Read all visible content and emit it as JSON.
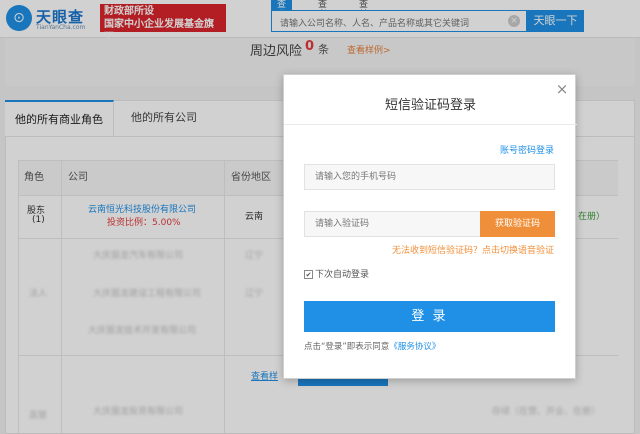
{
  "header": {
    "logo_mark": "⊙",
    "logo_name": "天眼查",
    "logo_domain": "TianYanCha.com",
    "gov_badge_line1": "财政部所设",
    "gov_badge_line2": "国家中小企业发展基金旗下",
    "nav_tabs": [
      "查公司",
      "查老板",
      "查关系"
    ],
    "search_placeholder": "请输入公司名称、人名、产品名称或其它关键词",
    "search_button": "天眼一下"
  },
  "risk": {
    "label": "周边风险",
    "count": "0",
    "unit": "条",
    "sample_link": "查看样例>"
  },
  "tabs": {
    "active": "他的所有商业角色",
    "inactive": "他的所有公司"
  },
  "table": {
    "headers": [
      "角色",
      "公司",
      "省份地区"
    ],
    "row1": {
      "role": "股东",
      "role_num": "(1)",
      "company": "云南恒光科技股份有限公司",
      "ratio": "投资比例：5.00%",
      "region": "云南",
      "status": "在册）"
    },
    "blurred": {
      "rows": [
        "大庆振龙汽车有限公司",
        "大庆振龙建设工程有限公司",
        "大庆振龙技术开发有限公司"
      ],
      "region": "辽宁",
      "role_legal": "法人",
      "role_exec": "高管",
      "sample_link": "查看样",
      "bottom_company": "大庆振龙投资有限公司",
      "bottom_status": "存续（在营、开业、在册）"
    }
  },
  "modal": {
    "title": "短信验证码登录",
    "close": "×",
    "password_login_link": "账号密码登录",
    "phone_placeholder": "请输入您的手机号码",
    "code_placeholder": "请输入验证码",
    "get_code_button": "获取验证码",
    "voice_link": "无法收到短信验证码？点击切换语音验证",
    "auto_login": "下次自动登录",
    "auto_login_checked": true,
    "login_button": "登 录",
    "agreement_prefix": "点击“登录”即表示同意",
    "agreement_link": "《服务协议》"
  }
}
